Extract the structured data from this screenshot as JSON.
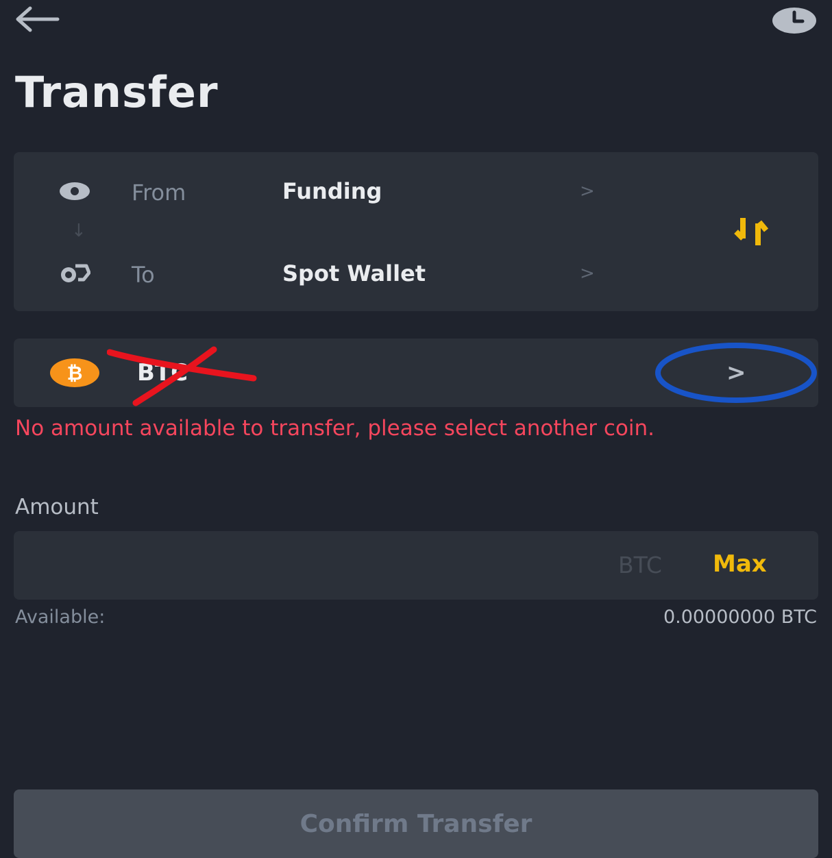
{
  "header": {
    "title": "Transfer",
    "back_icon": "arrow-left-icon",
    "history_icon": "clock-icon"
  },
  "wallets": {
    "from": {
      "label": "From",
      "value": "Funding"
    },
    "to": {
      "label": "To",
      "value": "Spot Wallet"
    },
    "swap_icon": "swap-arrows-icon"
  },
  "coin": {
    "symbol": "BTC",
    "icon": "bitcoin-icon"
  },
  "error": {
    "message": "No amount available to transfer, please select another coin."
  },
  "amount": {
    "label": "Amount",
    "unit": "BTC",
    "max_label": "Max",
    "value": ""
  },
  "available": {
    "label": "Available:",
    "value": "0.00000000 BTC"
  },
  "confirm": {
    "label": "Confirm Transfer"
  },
  "colors": {
    "background": "#1f232d",
    "card": "#2b3039",
    "accent": "#f0b90b",
    "error": "#f6465d",
    "annotation_red": "#e8141e",
    "annotation_blue": "#1854c8"
  }
}
